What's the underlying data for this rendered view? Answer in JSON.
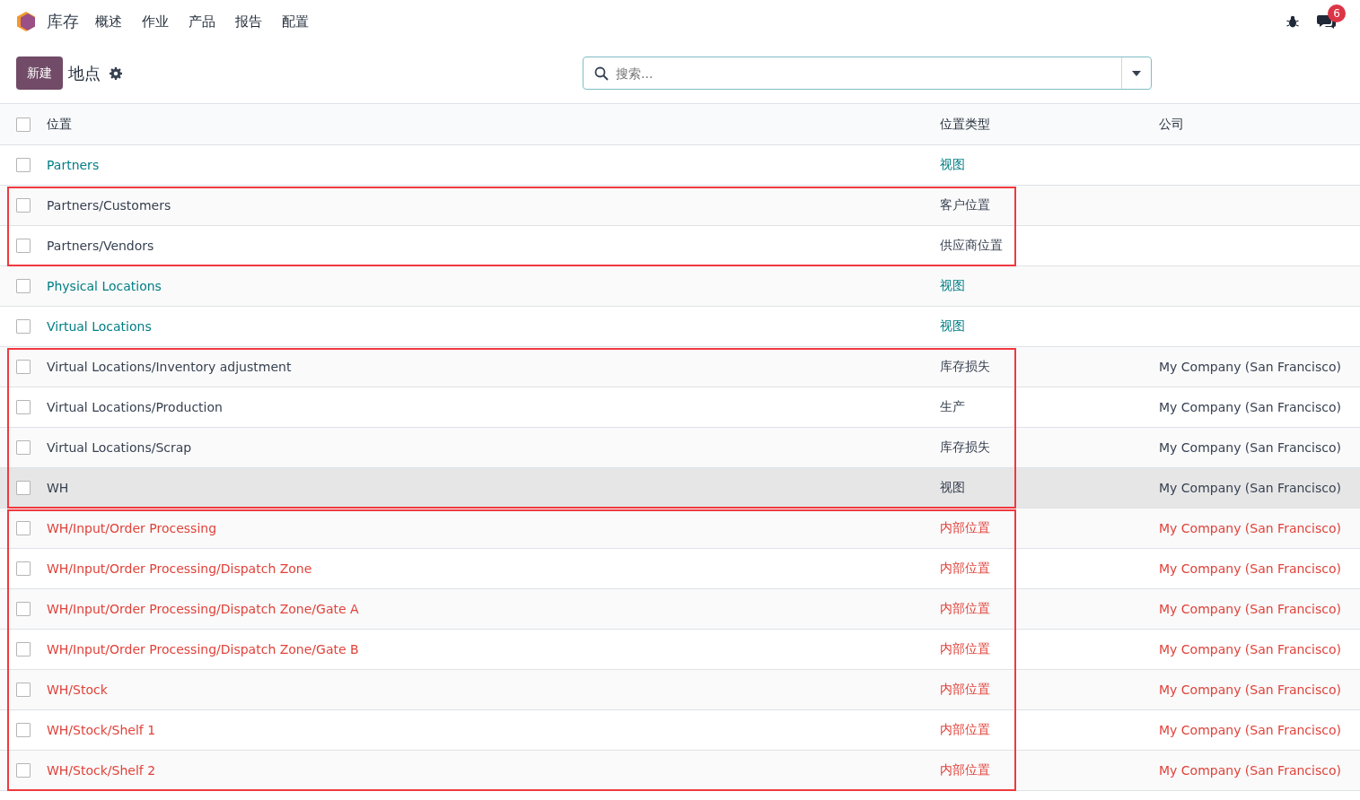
{
  "app": {
    "name": "库存"
  },
  "menu": [
    "概述",
    "作业",
    "产品",
    "报告",
    "配置"
  ],
  "notifications": {
    "count": "6"
  },
  "control_bar": {
    "new_button": "新建",
    "title": "地点"
  },
  "search": {
    "placeholder": "搜索..."
  },
  "table": {
    "columns": [
      "位置",
      "位置类型",
      "公司"
    ],
    "select_all": {
      "checked": false
    },
    "groups": [
      {
        "outlined": false,
        "rows": [
          {
            "name": "Partners",
            "type": "视图",
            "company": "",
            "kind": "link",
            "highlighted": false
          }
        ]
      },
      {
        "outlined": true,
        "rows": [
          {
            "name": "Partners/Customers",
            "type": "客户位置",
            "company": "",
            "kind": "plain",
            "highlighted": false
          },
          {
            "name": "Partners/Vendors",
            "type": "供应商位置",
            "company": "",
            "kind": "plain",
            "highlighted": false
          }
        ]
      },
      {
        "outlined": false,
        "rows": [
          {
            "name": "Physical Locations",
            "type": "视图",
            "company": "",
            "kind": "link",
            "highlighted": false
          },
          {
            "name": "Virtual Locations",
            "type": "视图",
            "company": "",
            "kind": "link",
            "highlighted": false
          }
        ]
      },
      {
        "outlined": true,
        "rows": [
          {
            "name": "Virtual Locations/Inventory adjustment",
            "type": "库存损失",
            "company": "My Company (San Francisco)",
            "kind": "plain",
            "highlighted": false
          },
          {
            "name": "Virtual Locations/Production",
            "type": "生产",
            "company": "My Company (San Francisco)",
            "kind": "plain",
            "highlighted": false
          },
          {
            "name": "Virtual Locations/Scrap",
            "type": "库存损失",
            "company": "My Company (San Francisco)",
            "kind": "plain",
            "highlighted": false
          },
          {
            "name": "WH",
            "type": "视图",
            "company": "My Company (San Francisco)",
            "kind": "plain",
            "highlighted": true
          }
        ]
      },
      {
        "outlined": true,
        "rows": [
          {
            "name": "WH/Input/Order Processing",
            "type": "内部位置",
            "company": "My Company (San Francisco)",
            "kind": "danger",
            "highlighted": false
          },
          {
            "name": "WH/Input/Order Processing/Dispatch Zone",
            "type": "内部位置",
            "company": "My Company (San Francisco)",
            "kind": "danger",
            "highlighted": false
          },
          {
            "name": "WH/Input/Order Processing/Dispatch Zone/Gate A",
            "type": "内部位置",
            "company": "My Company (San Francisco)",
            "kind": "danger",
            "highlighted": false
          },
          {
            "name": "WH/Input/Order Processing/Dispatch Zone/Gate B",
            "type": "内部位置",
            "company": "My Company (San Francisco)",
            "kind": "danger",
            "highlighted": false
          },
          {
            "name": "WH/Stock",
            "type": "内部位置",
            "company": "My Company (San Francisco)",
            "kind": "danger",
            "highlighted": false
          },
          {
            "name": "WH/Stock/Shelf 1",
            "type": "内部位置",
            "company": "My Company (San Francisco)",
            "kind": "danger",
            "highlighted": false
          },
          {
            "name": "WH/Stock/Shelf 2",
            "type": "内部位置",
            "company": "My Company (San Francisco)",
            "kind": "danger",
            "highlighted": false
          }
        ]
      }
    ]
  }
}
